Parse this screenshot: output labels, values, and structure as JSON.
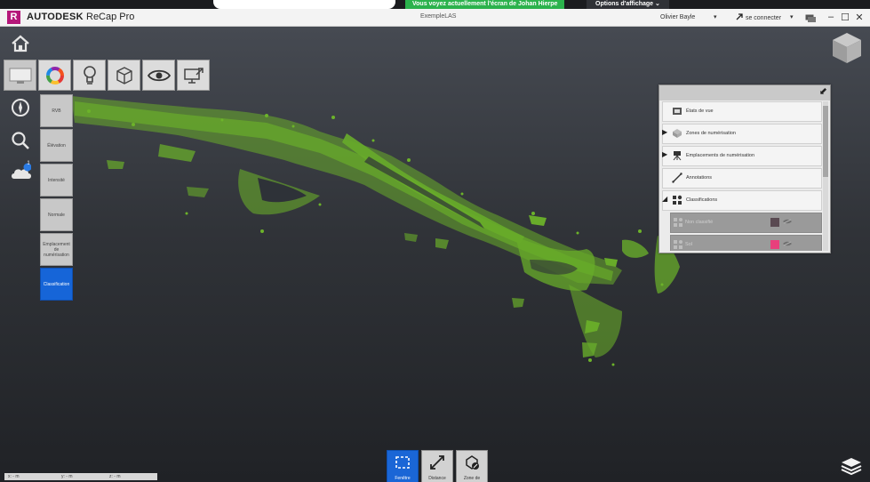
{
  "meeting": {
    "share_message": "Vous voyez actuellement l'écran de Johan Hierpe",
    "view_options": "Options d'affichage ⌄"
  },
  "app": {
    "logo_letter": "R",
    "brand_bold": "AUTODESK",
    "brand_name": "ReCap Pro",
    "document_title": "ExempleLAS",
    "user_name": "Olivier Bayle",
    "connect_label": "se connecter",
    "dropdown_glyph": "▾",
    "window_minimize": "–",
    "window_maximize": "☐",
    "window_close": "✕"
  },
  "display_modes": [
    {
      "label": "RVB",
      "selected": false
    },
    {
      "label": "Élévation",
      "selected": false
    },
    {
      "label": "Intensité",
      "selected": false
    },
    {
      "label": "Normale",
      "selected": false
    },
    {
      "label": "Emplacement de numérisation",
      "selected": false
    },
    {
      "label": "Classification",
      "selected": true
    }
  ],
  "toolbar_icons": [
    "display-settings-icon",
    "color-wheel-icon",
    "lightbulb-icon",
    "cube-icon",
    "eye-icon",
    "screen-export-icon"
  ],
  "left_icons": [
    "home-icon",
    "compass-icon",
    "search-icon",
    "cloud-icon"
  ],
  "cloud_badge": "1",
  "project_panel": {
    "collapse_glyph": "⬋",
    "items": [
      {
        "label": "États de vue",
        "icon": "view-states-icon",
        "expandable": false
      },
      {
        "label": "Zones de numérisation",
        "icon": "regions-icon",
        "expandable": true,
        "expanded": false
      },
      {
        "label": "Emplacements de numérisation",
        "icon": "scan-locations-icon",
        "expandable": true,
        "expanded": false
      },
      {
        "label": "Annotations",
        "icon": "annotation-line-icon",
        "expandable": false
      },
      {
        "label": "Classifications",
        "icon": "classifications-icon",
        "expandable": true,
        "expanded": true
      }
    ],
    "classes": [
      {
        "label": "Non classifié",
        "color": "#5a4a52"
      },
      {
        "label": "Sol",
        "color": "#e8407c"
      },
      {
        "label": "",
        "color": "#9ac832"
      }
    ]
  },
  "bottom_tools": [
    {
      "label": "Fenêtre",
      "icon": "window-select-icon",
      "active": true
    },
    {
      "label": "Distance",
      "icon": "distance-icon",
      "active": false
    },
    {
      "label": "Zone de",
      "icon": "zone-icon",
      "active": false
    }
  ],
  "coordinates": {
    "x": "x: - m",
    "y": "y: - m",
    "z": "z: - m"
  },
  "colors": {
    "point_cloud": "#6cb32a",
    "selected_blue": "#1665d8",
    "brand": "#b5177a"
  }
}
